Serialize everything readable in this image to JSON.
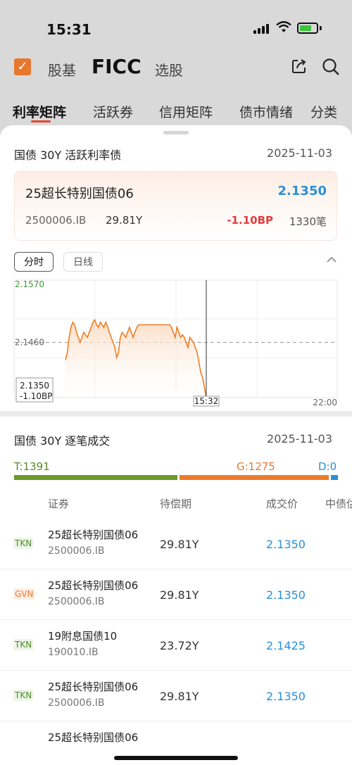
{
  "status_bar": {
    "time": "15:31"
  },
  "header": {
    "logo": "checkbox-logo",
    "tabs": [
      "股基",
      "FICC",
      "选股"
    ],
    "active_tab": "FICC"
  },
  "sub_tabs": [
    "利率矩阵",
    "活跃券",
    "信用矩阵",
    "债市情绪",
    "分类"
  ],
  "active_sub_tab": "利率矩阵",
  "active_section": {
    "title": "国债 30Y 活跃利率债",
    "date": "2025-11-03",
    "quote": {
      "name": "25超长特别国债06",
      "price": "2.1350",
      "code": "2500006.IB",
      "term": "29.81Y",
      "change": "-1.10BP",
      "count": "1330笔"
    }
  },
  "chart_controls": {
    "intraday": "分时",
    "daily": "日线",
    "collapse_icon": "chevron-up-icon"
  },
  "chart_data": {
    "type": "line",
    "y_top_label": "2.1570",
    "y_mid_label": "2.1460",
    "current_value_label": "2.1350",
    "current_change_label": "-1.10BP",
    "cursor_time_label": "15:32",
    "end_time_label": "22:00",
    "ylim": [
      2.135,
      2.157
    ],
    "reference_value": 2.146,
    "grid": true,
    "colors": {
      "line": "#ef7d22",
      "fill": "#fbd9bf",
      "top_label": "#3a9a3a"
    },
    "series": [
      {
        "values": [
          2.1425,
          2.144,
          2.147,
          2.149,
          2.15,
          2.1495,
          2.148,
          2.147,
          2.146,
          2.147,
          2.148,
          2.1475,
          2.147,
          2.148,
          2.149,
          2.15,
          2.1505,
          2.1495,
          2.149,
          2.15,
          2.1495,
          2.149,
          2.15,
          2.1492,
          2.148,
          2.147,
          2.146,
          2.145,
          2.143,
          2.144,
          2.147,
          2.148,
          2.1475,
          2.147,
          2.148,
          2.149,
          2.148,
          2.147,
          2.148,
          2.149,
          2.1495,
          2.1495,
          2.1495,
          2.1495,
          2.1495,
          2.1495,
          2.1495,
          2.1495,
          2.1495,
          2.1495,
          2.1495,
          2.1495,
          2.1495,
          2.1495,
          2.1495,
          2.1495,
          2.1495,
          2.1495,
          2.149,
          2.148,
          2.147,
          2.149,
          2.148,
          2.147,
          2.1475,
          2.147,
          2.146,
          2.145,
          2.147,
          2.1465,
          2.146,
          2.145,
          2.144,
          2.142,
          2.14,
          2.139,
          2.137,
          2.135
        ]
      }
    ]
  },
  "trades_section": {
    "title": "国债 30Y 逐笔成交",
    "date": "2025-11-03",
    "ratio": {
      "t_label": "T:1391",
      "g_label": "G:1275",
      "d_label": "D:0",
      "t": 1391,
      "g": 1275,
      "d": 0
    },
    "colors": {
      "t": "#6a9a2a",
      "g": "#ee7a2b",
      "d": "#2a8fd8"
    },
    "columns": [
      "证券",
      "待偿期",
      "成交价",
      "中债估值"
    ],
    "rows": [
      {
        "badge": "TKN",
        "name": "25超长特别国债06",
        "code": "2500006.IB",
        "term": "29.81Y",
        "price": "2.1350"
      },
      {
        "badge": "GVN",
        "name": "25超长特别国债06",
        "code": "2500006.IB",
        "term": "29.81Y",
        "price": "2.1350"
      },
      {
        "badge": "TKN",
        "name": "19附息国债10",
        "code": "190010.IB",
        "term": "23.72Y",
        "price": "2.1425"
      },
      {
        "badge": "TKN",
        "name": "25超长特别国债06",
        "code": "2500006.IB",
        "term": "29.81Y",
        "price": "2.1350"
      },
      {
        "badge": "",
        "name": "25超长特别国债06",
        "code": "",
        "term": "",
        "price": ""
      }
    ]
  }
}
